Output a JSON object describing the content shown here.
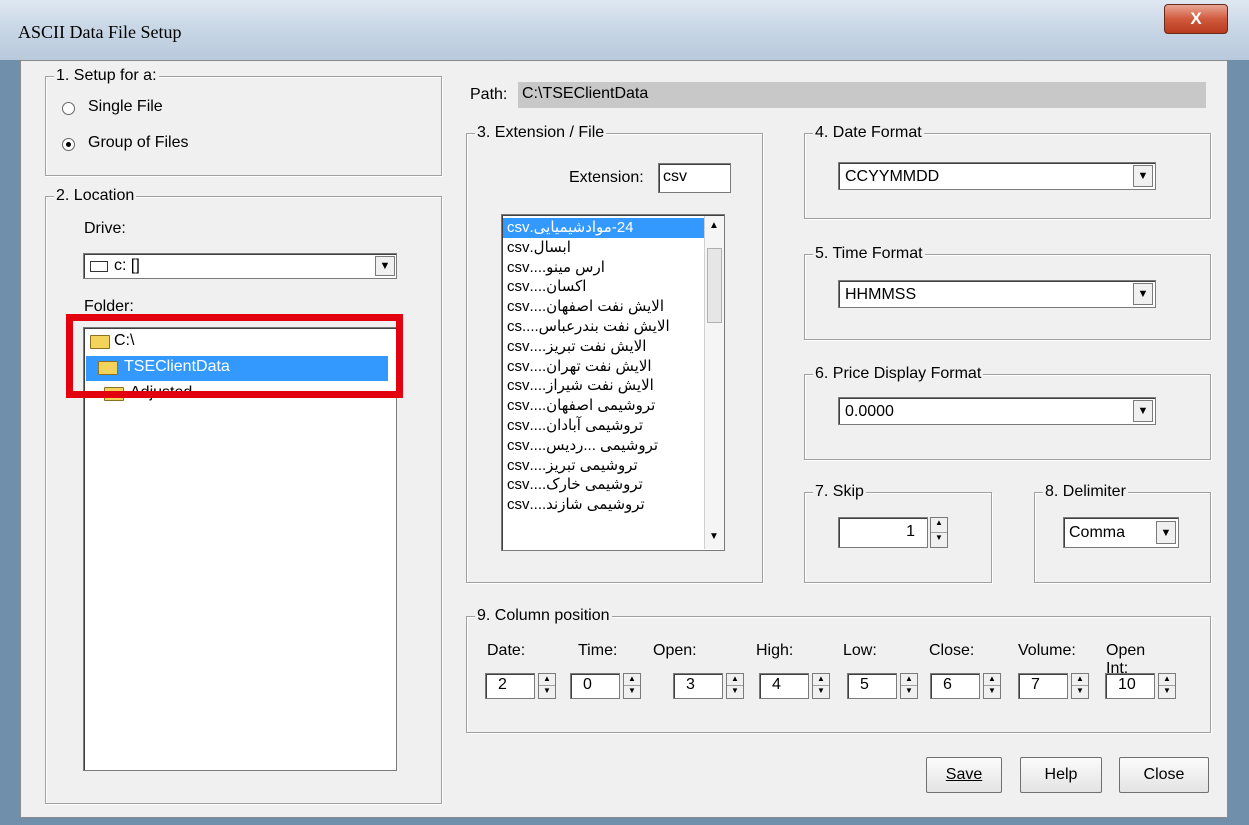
{
  "window": {
    "title": "ASCII Data File Setup",
    "close_glyph": "X"
  },
  "setup": {
    "legend": "1. Setup for a:",
    "options": [
      "Single File",
      "Group of Files"
    ],
    "selected": "Group of Files"
  },
  "location": {
    "legend": "2. Location",
    "drive_label": "Drive:",
    "drive_value": "c: []",
    "folder_label": "Folder:",
    "folders": [
      "C:\\",
      "TSEClientData",
      "Adjusted"
    ],
    "selected_folder": "TSEClientData"
  },
  "path": {
    "label": "Path:",
    "value": "C:\\TSEClientData"
  },
  "extension": {
    "legend": "3. Extension / File",
    "label": "Extension:",
    "value": "csv",
    "files": [
      "24-موادشیمیایی.csv",
      "ابسال.csv",
      "ارس مینو....csv",
      "اکسان....csv",
      "الایش نفت اصفهان....csv",
      "الایش نفت بندرعباس....cs",
      "الایش نفت تبریز....csv",
      "الایش نفت تهران....csv",
      "الایش نفت شیراز....csv",
      "تروشیمی اصفهان....csv",
      "تروشیمی آبادان....csv",
      "تروشیمی ...ردیس....csv",
      "تروشیمی تبریز....csv",
      "تروشیمی خارک....csv",
      "تروشیمی شازند....csv"
    ]
  },
  "date_format": {
    "legend": "4. Date Format",
    "value": "CCYYMMDD"
  },
  "time_format": {
    "legend": "5. Time Format",
    "value": "HHMMSS"
  },
  "price_format": {
    "legend": "6. Price Display Format",
    "value": "0.0000"
  },
  "skip": {
    "legend": "7. Skip",
    "value": "1"
  },
  "delimiter": {
    "legend": "8. Delimiter",
    "value": "Comma"
  },
  "columns": {
    "legend": "9. Column position",
    "items": [
      {
        "label": "Date:",
        "value": "2"
      },
      {
        "label": "Time:",
        "value": "0"
      },
      {
        "label": "Open:",
        "value": "3"
      },
      {
        "label": "High:",
        "value": "4"
      },
      {
        "label": "Low:",
        "value": "5"
      },
      {
        "label": "Close:",
        "value": "6"
      },
      {
        "label": "Volume:",
        "value": "7"
      },
      {
        "label": "Open Int:",
        "value": "10"
      }
    ]
  },
  "buttons": {
    "save": "Save",
    "help": "Help",
    "close": "Close"
  },
  "highlight_color": "#e3000f"
}
